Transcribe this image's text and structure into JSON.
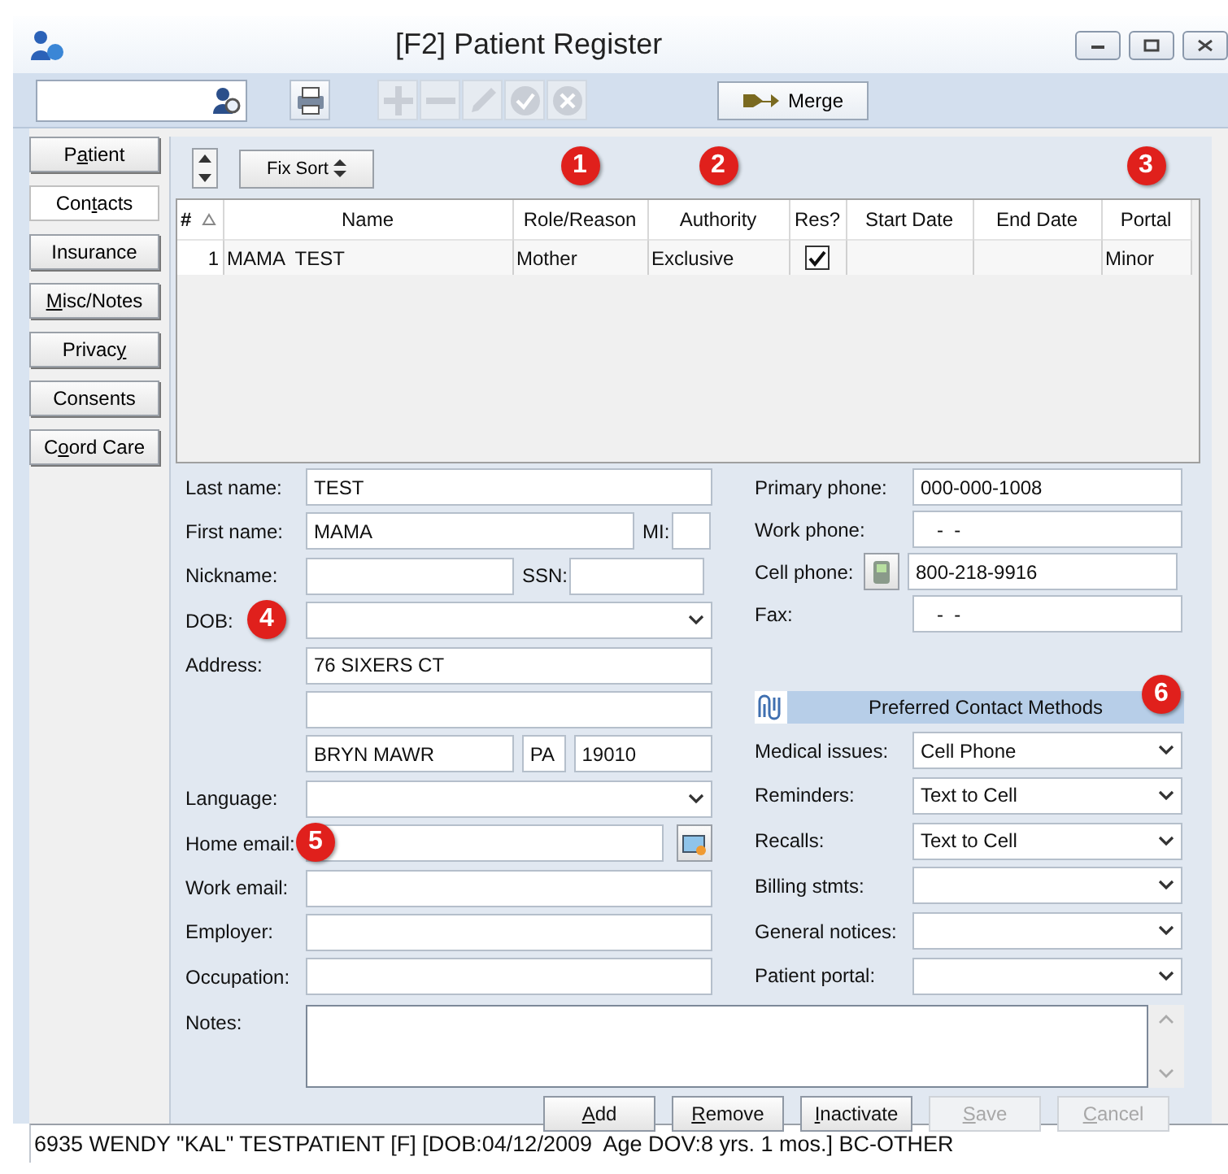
{
  "window": {
    "title": "[F2] Patient Register"
  },
  "toolbar": {
    "tools": [
      {
        "kind": "print",
        "disabled": false
      },
      {
        "kind": "add",
        "disabled": true
      },
      {
        "kind": "remove",
        "disabled": true
      },
      {
        "kind": "edit",
        "disabled": true
      },
      {
        "kind": "confirm",
        "disabled": true
      },
      {
        "kind": "cancel",
        "disabled": true
      }
    ],
    "merge_button": "Merge"
  },
  "side_tabs": [
    {
      "label": "Patient",
      "selected": false
    },
    {
      "label": "Contacts",
      "selected": true
    },
    {
      "label": "Insurance",
      "selected": false
    },
    {
      "label": "Misc/Notes",
      "selected": false
    },
    {
      "label": "Privacy",
      "selected": false
    },
    {
      "label": "Consents",
      "selected": false
    },
    {
      "label": "Coord Care",
      "selected": false
    }
  ],
  "grid": {
    "sort_button": "Fix Sort",
    "columns": [
      {
        "label": "#",
        "sorted": true
      },
      {
        "label": "Name",
        "sorted": false
      },
      {
        "label": "Role/Reason",
        "sorted": false,
        "callout": "1"
      },
      {
        "label": "Authority",
        "sorted": false,
        "callout": "2"
      },
      {
        "label": "Res?",
        "sorted": false
      },
      {
        "label": "Start Date",
        "sorted": false
      },
      {
        "label": "End Date",
        "sorted": false
      },
      {
        "label": "Portal",
        "sorted": false,
        "callout": "3"
      }
    ],
    "rows": [
      {
        "number": "1",
        "name": "MAMA  TEST",
        "role_reason": "Mother",
        "authority": "Exclusive",
        "resident": true,
        "portal": "Minor"
      }
    ]
  },
  "form": {
    "left": [
      {
        "kind": "text",
        "label": "Last name:",
        "value": "TEST"
      },
      {
        "kind": "text_mi",
        "label": "First name:",
        "value": "MAMA",
        "sub_label": "MI:"
      },
      {
        "kind": "text_ssn",
        "label": "Nickname:",
        "sub_label": "SSN:"
      },
      {
        "kind": "select",
        "label": "DOB:",
        "callout": "4"
      },
      {
        "kind": "text",
        "label": "Address:",
        "value": "76 SIXERS CT"
      },
      {
        "kind": "text"
      },
      {
        "kind": "city",
        "city": "BRYN MAWR",
        "state": "PA",
        "zip": "19010"
      },
      {
        "kind": "select",
        "label": "Language:"
      },
      {
        "kind": "email",
        "label": "Home email:",
        "callout": "5"
      },
      {
        "kind": "text",
        "label": "Work email:"
      },
      {
        "kind": "text",
        "label": "Employer:"
      },
      {
        "kind": "text",
        "label": "Occupation:"
      }
    ],
    "phones": [
      {
        "kind": "text",
        "label": "Primary phone:",
        "value": "000-000-1008"
      },
      {
        "kind": "text",
        "label": "Work phone:",
        "value": "-  -"
      },
      {
        "kind": "cell",
        "label": "Cell phone:",
        "value": "800-218-9916"
      },
      {
        "kind": "text",
        "label": "Fax:",
        "value": "-  -"
      }
    ],
    "preferred": {
      "title": "Preferred Contact Methods",
      "callout": "6",
      "items": [
        {
          "label": "Medical issues:",
          "value": "Cell Phone"
        },
        {
          "label": "Reminders:",
          "value": "Text to Cell"
        },
        {
          "label": "Recalls:",
          "value": "Text to Cell"
        },
        {
          "label": "Billing stmts:"
        },
        {
          "label": "General notices:"
        },
        {
          "label": "Patient portal:"
        }
      ]
    },
    "notes": {
      "label": "Notes:"
    },
    "buttons": [
      {
        "label": "Add",
        "disabled": false
      },
      {
        "label": "Remove",
        "disabled": false
      },
      {
        "label": "Inactivate",
        "disabled": false
      },
      {
        "label": "Save",
        "disabled": true
      },
      {
        "label": "Cancel",
        "disabled": true
      }
    ]
  },
  "status_bar": "6935 WENDY \"KAL\" TESTPATIENT [F] [DOB:04/12/2009  Age DOV:8 yrs. 1 mos.] BC-OTHER"
}
